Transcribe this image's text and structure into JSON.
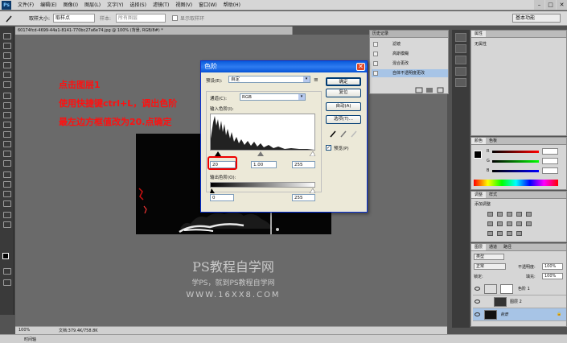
{
  "app": {
    "logo": "Ps"
  },
  "menu": [
    "文件(F)",
    "编辑(E)",
    "图像(I)",
    "图层(L)",
    "文字(Y)",
    "选择(S)",
    "滤镜(T)",
    "视图(V)",
    "窗口(W)",
    "帮助(H)"
  ],
  "window_controls": [
    "–",
    "□",
    "✕"
  ],
  "options": {
    "sample_size_label": "取样大小:",
    "sample_size_value": "取样点",
    "sample_label": "样本:",
    "sample_value": "所有图层",
    "show_ring_label": "显示取样环",
    "workspace": "基本功能"
  },
  "document": {
    "tab": "60174fcd-4699-44a1-8141-770bc27a6e74.jpg @ 100% (背景, RGB/8#) *",
    "zoom": "100%",
    "doc_info": "文档:379.4K/758.8K"
  },
  "annotations": {
    "line1": "点击图层1",
    "line2": "使用快捷键ctrl+L，调出色阶",
    "line3": "最左边方框值改为20.点确定"
  },
  "watermark": {
    "line1": "PS教程自学网",
    "line2": "学PS，就到PS教程自学网",
    "line3": "WWW.16XX8.COM"
  },
  "history": {
    "tab": "历史记录",
    "items": [
      "滤镜",
      "高斯模糊",
      "混合更改",
      "自体不透明度更改"
    ],
    "selected_index": 3
  },
  "properties": {
    "tab": "属性",
    "text": "无属性"
  },
  "color_panel": {
    "tabs": [
      "颜色",
      "色板"
    ],
    "channels": [
      "R",
      "G",
      "B"
    ],
    "values": [
      "",
      "",
      ""
    ]
  },
  "adjust_panel": {
    "tabs": [
      "调整",
      "样式"
    ],
    "hint": "添加调整"
  },
  "layers": {
    "tabs": [
      "图层",
      "通道",
      "路径"
    ],
    "kind_label": "类型",
    "blend_mode": "正常",
    "opacity_label": "不透明度:",
    "opacity_value": "100%",
    "lock_label": "锁定:",
    "fill_label": "填充:",
    "fill_value": "100%",
    "rows": [
      {
        "name": "色阶 1"
      },
      {
        "name": "图层 2"
      },
      {
        "name": "背景"
      }
    ]
  },
  "levels_dialog": {
    "title": "色阶",
    "close": "✕",
    "preset_label": "预设(E):",
    "preset_value": "自定",
    "channel_label": "通道(C):",
    "channel_value": "RGB",
    "input_label": "输入色阶(I):",
    "input_values": [
      "20",
      "1.00",
      "255"
    ],
    "output_label": "输出色阶(O):",
    "output_values": [
      "0",
      "255"
    ],
    "buttons": [
      "确定",
      "复位",
      "自动(A)",
      "选项(T)..."
    ],
    "preview_label": "预览(P)",
    "preview_checked": true
  },
  "bottom_tab": "时间轴",
  "colors": {
    "accent": "#0a5bdc",
    "annotation": "#ff1010",
    "highlight": "#e00000"
  }
}
